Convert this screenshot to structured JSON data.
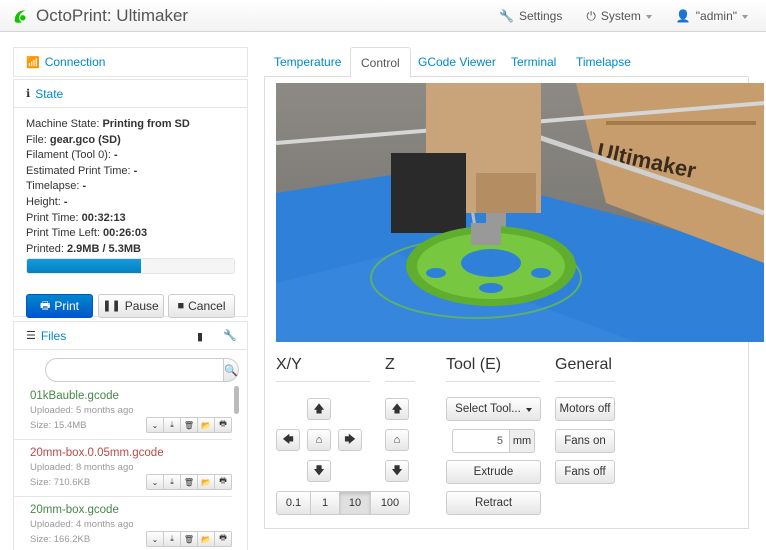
{
  "navbar": {
    "brand": "OctoPrint: Ultimaker",
    "settings": "Settings",
    "system": "System",
    "user": "\"admin\""
  },
  "sidebar": {
    "connection_title": "Connection",
    "state_title": "State",
    "state": {
      "machine_state_label": "Machine State:",
      "machine_state": "Printing from SD",
      "file_label": "File:",
      "file": "gear.gco (SD)",
      "filament_label": "Filament (Tool 0):",
      "filament": "-",
      "est_time_label": "Estimated Print Time:",
      "est_time": "-",
      "timelapse_label": "Timelapse:",
      "timelapse": "-",
      "height_label": "Height:",
      "height": "-",
      "print_time_label": "Print Time:",
      "print_time": "00:32:13",
      "time_left_label": "Print Time Left:",
      "time_left": "00:26:03",
      "printed_label": "Printed:",
      "printed": "2.9MB / 5.3MB",
      "progress_percent": 55
    },
    "buttons": {
      "print": "Print",
      "pause": "Pause",
      "cancel": "Cancel"
    },
    "files_title": "Files",
    "files": [
      {
        "name": "01kBauble.gcode",
        "uploaded": "Uploaded: 5 months ago",
        "size": "Size: 15.4MB",
        "color": "#468847"
      },
      {
        "name": "20mm-box.0.05mm.gcode",
        "uploaded": "Uploaded: 8 months ago",
        "size": "Size: 710.6KB",
        "color": "#b94a48"
      },
      {
        "name": "20mm-box.gcode",
        "uploaded": "Uploaded: 4 months ago",
        "size": "Size: 166.2KB",
        "color": "#468847"
      }
    ]
  },
  "tabs": [
    "Temperature",
    "Control",
    "GCode Viewer",
    "Terminal",
    "Timelapse"
  ],
  "webcam": {
    "label": "Ultimaker"
  },
  "control": {
    "xy_title": "X/Y",
    "z_title": "Z",
    "tool_title": "Tool (E)",
    "general_title": "General",
    "select_tool": "Select Tool...",
    "extrude_amount": "5",
    "extrude_unit": "mm",
    "extrude": "Extrude",
    "retract": "Retract",
    "motors_off": "Motors off",
    "fans_on": "Fans on",
    "fans_off": "Fans off",
    "steps": [
      "0.1",
      "1",
      "10",
      "100"
    ]
  },
  "colors": {
    "accent": "#0088cc",
    "progress": "#0480be",
    "gear": "#6fc23a",
    "bed": "#2e7fd6"
  }
}
